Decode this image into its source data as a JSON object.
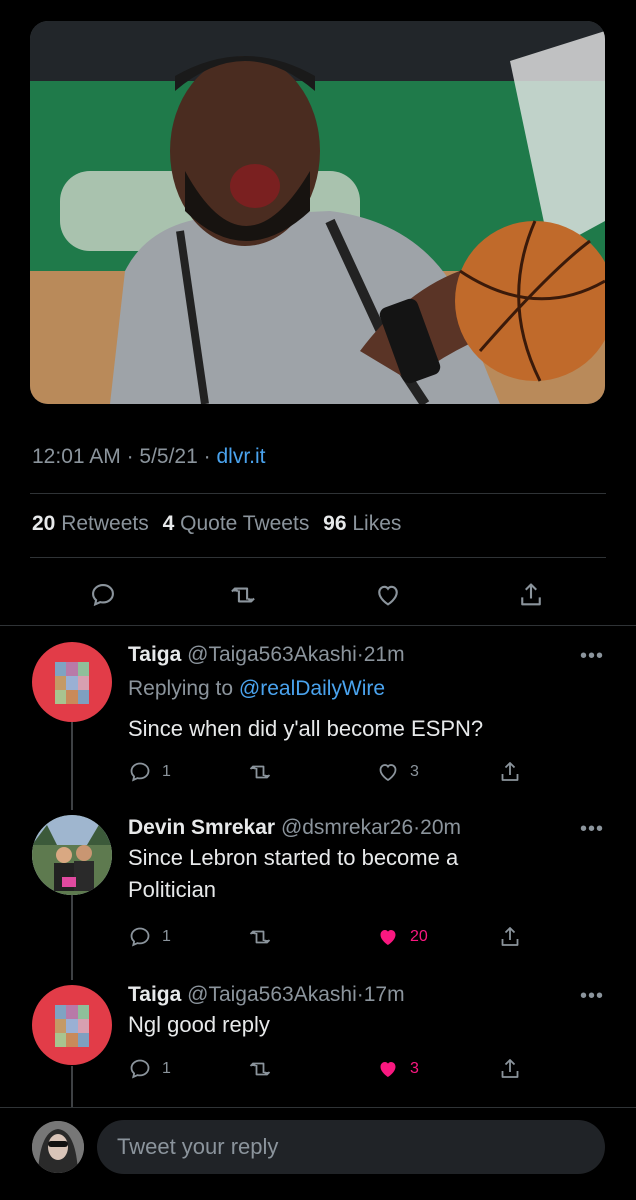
{
  "tweet": {
    "media": {
      "description": "basketball-player-photo",
      "court_green": "#1f7a4a"
    },
    "time": "12:01 AM",
    "date": "5/5/21",
    "source": "dlvr.it",
    "stats": {
      "retweets_count": "20",
      "retweets_label": "Retweets",
      "quotes_count": "4",
      "quotes_label": "Quote Tweets",
      "likes_count": "96",
      "likes_label": "Likes"
    }
  },
  "replies": [
    {
      "name": "Taiga",
      "handle": "@Taiga563Akashi",
      "time": "21m",
      "replying_prefix": "Replying to",
      "replying_to": "@realDailyWire",
      "lines": [
        "Since when did y'all become ESPN?"
      ],
      "reply_count": "1",
      "retweet_count": "",
      "like_count": "3",
      "liked": false
    },
    {
      "name": "Devin Smrekar",
      "handle": "@dsmrekar26",
      "time": "20m",
      "lines": [
        "Since Lebron started to become a",
        "Politician"
      ],
      "reply_count": "1",
      "retweet_count": "",
      "like_count": "20",
      "liked": true
    },
    {
      "name": "Taiga",
      "handle": "@Taiga563Akashi",
      "time": "17m",
      "lines": [
        "Ngl good reply"
      ],
      "reply_count": "1",
      "retweet_count": "",
      "like_count": "3",
      "liked": true
    }
  ],
  "composer": {
    "placeholder": "Tweet your reply"
  },
  "colors": {
    "accent": "#4aa3ee",
    "like": "#f91880",
    "avatar_red": "#e23c48"
  }
}
